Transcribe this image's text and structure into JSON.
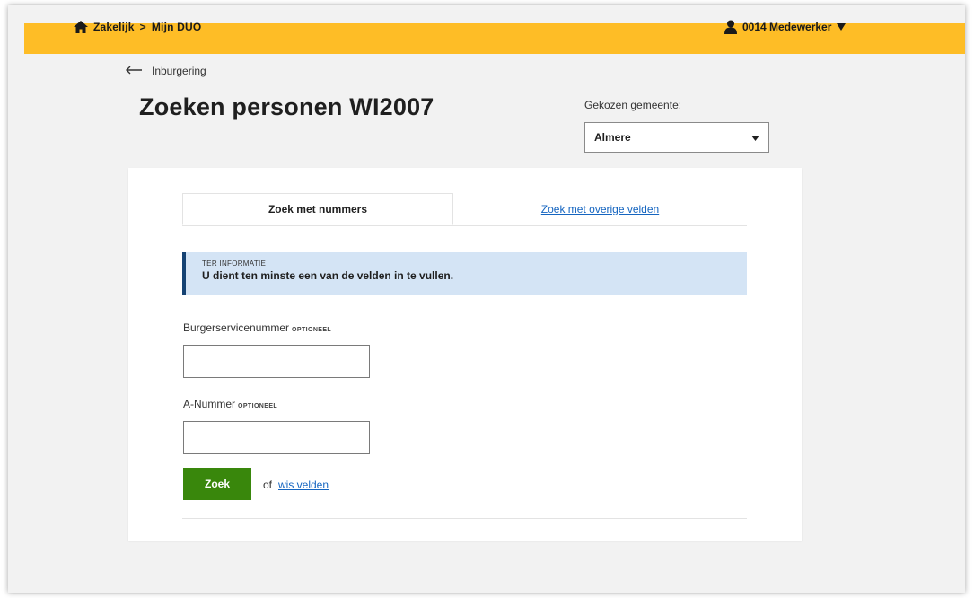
{
  "topbar": {
    "crumbs": [
      "Zakelijk",
      "Mijn DUO"
    ],
    "separator": ">",
    "user_label": "0014 Medewerker",
    "accent_color": "#febd26"
  },
  "back_link": {
    "label": "Inburgering"
  },
  "page_title": "Zoeken personen WI2007",
  "gemeente": {
    "label": "Gekozen gemeente:",
    "selected": "Almere"
  },
  "tabs": [
    {
      "label": "Zoek met nummers",
      "active": true
    },
    {
      "label": "Zoek met overige velden",
      "active": false
    }
  ],
  "info": {
    "heading": "TER INFORMATIE",
    "message": "U dient ten minste een van de velden in te vullen."
  },
  "fields": {
    "bsn": {
      "label": "Burgerservicenummer",
      "optional": "OPTIONEEL",
      "value": ""
    },
    "anummer": {
      "label": "A-Nummer",
      "optional": "OPTIONEEL",
      "value": ""
    }
  },
  "actions": {
    "submit_label": "Zoek",
    "or_text": "of",
    "clear_label": "wis velden",
    "submit_color": "#39870c",
    "link_color": "#1565c0"
  },
  "icons": {
    "home": "home-icon",
    "user": "user-icon",
    "caret": "caret-down-icon",
    "back": "arrow-left-icon",
    "select": "chevron-down-icon"
  }
}
